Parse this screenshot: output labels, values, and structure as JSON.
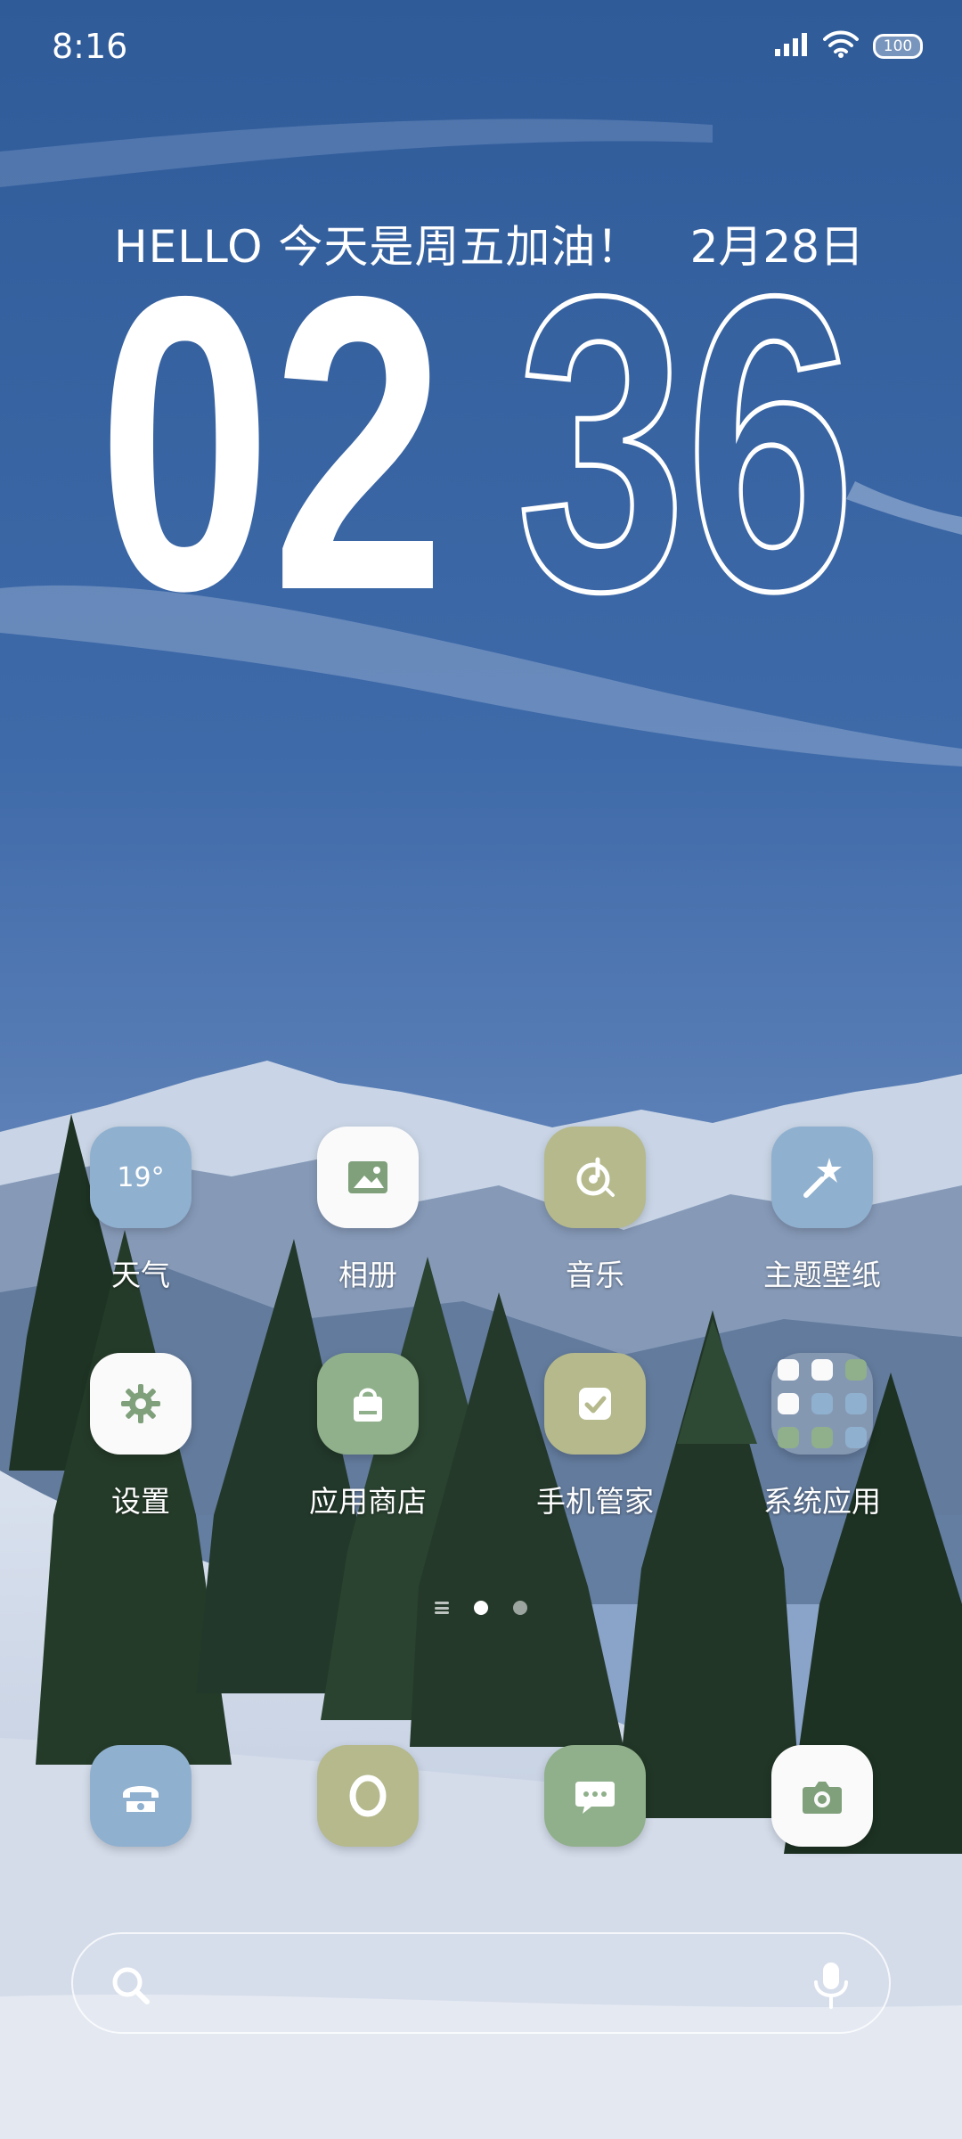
{
  "status_bar": {
    "time": "8:16",
    "battery": "100"
  },
  "greeting": "HELLO 今天是周五加油！",
  "date": "2月28日",
  "clock": {
    "hours": "02",
    "minutes": "36"
  },
  "apps": [
    {
      "label": "天气",
      "icon": "weather-icon",
      "temp": "19°",
      "color": "#8fb0cf"
    },
    {
      "label": "相册",
      "icon": "gallery-icon",
      "color": "#fafafa"
    },
    {
      "label": "音乐",
      "icon": "music-icon",
      "color": "#b5b98b"
    },
    {
      "label": "主题壁纸",
      "icon": "theme-icon",
      "color": "#8fb0cf"
    },
    {
      "label": "设置",
      "icon": "gear-icon",
      "color": "#fafafa"
    },
    {
      "label": "应用商店",
      "icon": "shopping-bag-icon",
      "color": "#8fb08a"
    },
    {
      "label": "手机管家",
      "icon": "security-check-icon",
      "color": "#b5b98b"
    },
    {
      "label": "系统应用",
      "icon": "folder-icon",
      "color": "#ffffff"
    }
  ],
  "dock": [
    {
      "icon": "phone-icon",
      "color": "#8fb0cf"
    },
    {
      "icon": "browser-icon",
      "color": "#b5b98b"
    },
    {
      "icon": "message-icon",
      "color": "#8fb08a"
    },
    {
      "icon": "camera-icon",
      "color": "#fafafa"
    }
  ],
  "search": {
    "placeholder": ""
  },
  "page_indicator": {
    "total_pages": 2,
    "current_page": 1
  }
}
